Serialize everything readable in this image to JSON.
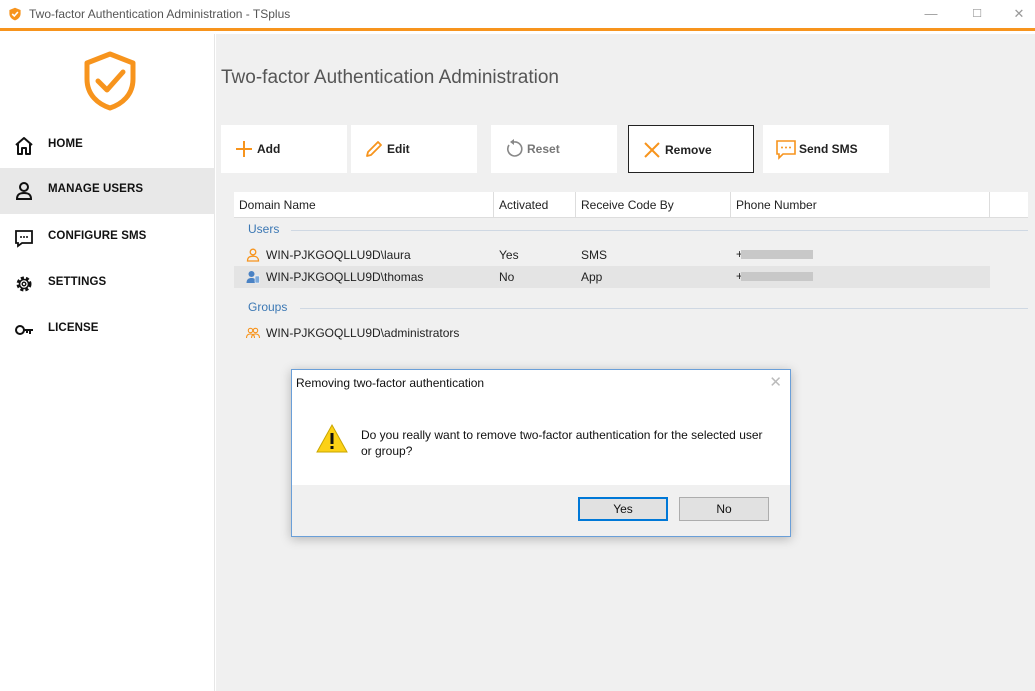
{
  "window": {
    "title": "Two-factor Authentication Administration - TSplus",
    "minimize": "—",
    "maximize": "☐",
    "close": "✕"
  },
  "colors": {
    "accent": "#f7941d",
    "link_blue": "#3c78b4",
    "dialog_border": "#6a9fd8"
  },
  "sidebar": {
    "items": [
      {
        "label": "HOME",
        "icon": "home-icon",
        "active": false
      },
      {
        "label": "MANAGE USERS",
        "icon": "user-icon",
        "active": true
      },
      {
        "label": "CONFIGURE SMS",
        "icon": "sms-icon",
        "active": false
      },
      {
        "label": "SETTINGS",
        "icon": "gear-icon",
        "active": false
      },
      {
        "label": "LICENSE",
        "icon": "key-icon",
        "active": false
      }
    ]
  },
  "main": {
    "title": "Two-factor Authentication Administration",
    "toolbar": [
      {
        "label": "Add",
        "icon": "plus-icon"
      },
      {
        "label": "Edit",
        "icon": "pencil-icon"
      },
      {
        "label": "Reset",
        "icon": "reset-icon"
      },
      {
        "label": "Remove",
        "icon": "x-icon"
      },
      {
        "label": "Send SMS",
        "icon": "sms-icon"
      }
    ],
    "table": {
      "columns": [
        "Domain Name",
        "Activated",
        "Receive Code By",
        "Phone Number"
      ],
      "users_header": "Users",
      "groups_header": "Groups",
      "users": [
        {
          "name": "WIN-PJKGOQLLU9D\\laura",
          "activated": "Yes",
          "method": "SMS",
          "phone": "+"
        },
        {
          "name": "WIN-PJKGOQLLU9D\\thomas",
          "activated": "No",
          "method": "App",
          "phone": "+"
        }
      ],
      "groups": [
        {
          "name": "WIN-PJKGOQLLU9D\\administrators"
        }
      ]
    }
  },
  "dialog": {
    "title": "Removing two-factor authentication",
    "close": "✕",
    "message": "Do you really want to remove two-factor authentication for the selected user or group?",
    "yes": "Yes",
    "no": "No"
  }
}
